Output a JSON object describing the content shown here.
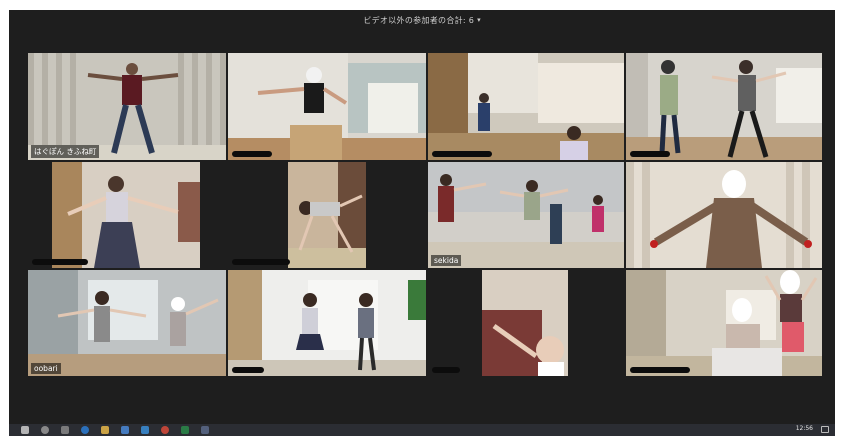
{
  "header": {
    "title": "ビデオ以外の参加者の合計: 6",
    "caret": "▾"
  },
  "tiles": [
    {
      "name": "はぐぽん きふね町"
    },
    {
      "name": ""
    },
    {
      "name": ""
    },
    {
      "name": ""
    },
    {
      "name": ""
    },
    {
      "name": ""
    },
    {
      "name": "sekida"
    },
    {
      "name": ""
    },
    {
      "name": "oobari"
    },
    {
      "name": ""
    },
    {
      "name": ""
    },
    {
      "name": ""
    }
  ],
  "taskbar": {
    "clock": "12:56",
    "icons": [
      "start-icon",
      "search-icon",
      "taskview-icon",
      "edge-icon",
      "explorer-icon",
      "store-icon",
      "mail-icon",
      "chrome-icon",
      "excel-icon",
      "zoom-icon"
    ]
  },
  "colors": {
    "active_speaker_border": "#d6f07a",
    "window_bg": "#1e1e1e"
  }
}
